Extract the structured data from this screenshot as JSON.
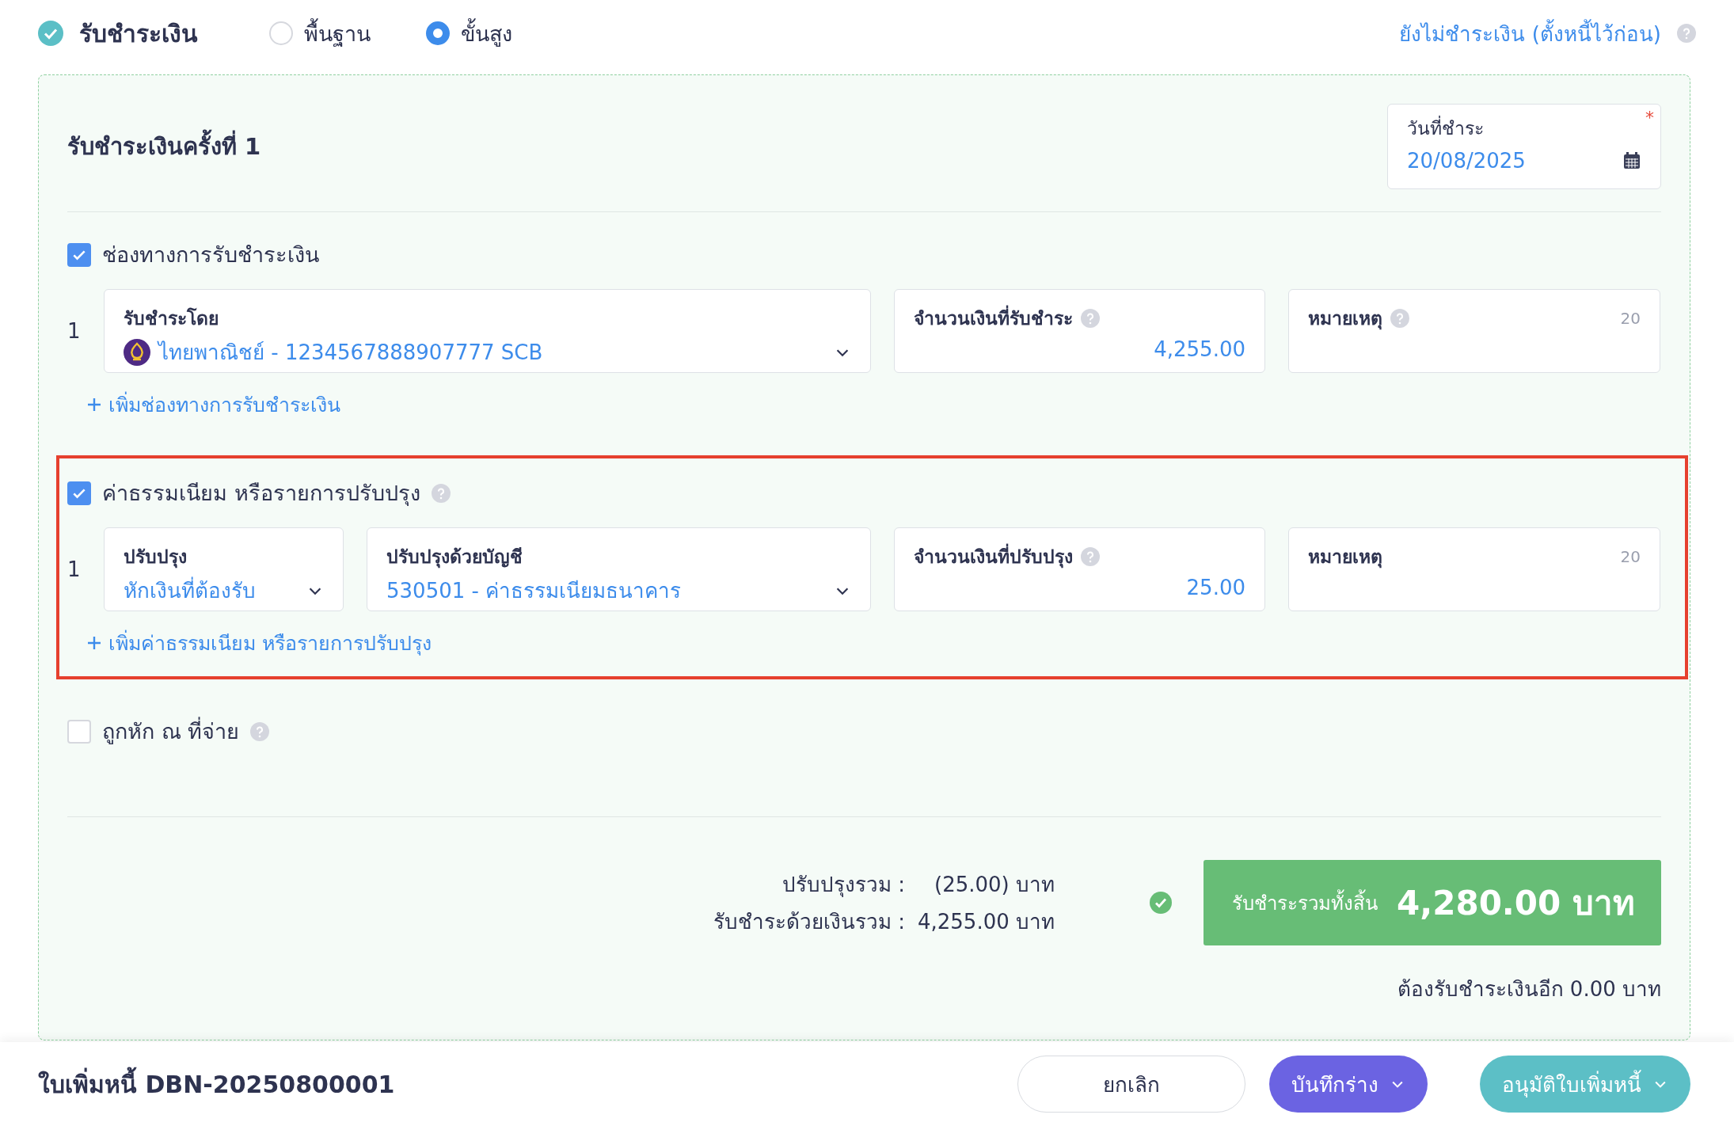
{
  "header": {
    "title": "รับชำระเงิน",
    "modes": [
      {
        "label": "พื้นฐาน",
        "selected": false
      },
      {
        "label": "ขั้นสูง",
        "selected": true
      }
    ],
    "defer_link": "ยังไม่ชำระเงิน (ตั้งหนี้ไว้ก่อน)"
  },
  "payment": {
    "title": "รับชำระเงินครั้งที่ 1",
    "date_field": {
      "label": "วันที่ชำระ",
      "value": "20/08/2025",
      "required_mark": "*"
    },
    "sections": [
      {
        "label": "ช่องทางการรับชำระเงิน",
        "checked": true,
        "help": false,
        "highlighted": false,
        "add_link": "เพิ่มช่องทางการรับชำระเงิน",
        "rows": [
          {
            "number": "1",
            "fields": [
              {
                "kind": "select",
                "label": "รับชำระโดย",
                "value": "ไทยพาณิชย์ - 1234567888907777 SCB",
                "bank_logo": true
              },
              {
                "kind": "amount",
                "label": "จำนวนเงินที่รับชำระ",
                "help": true,
                "value": "4,255.00"
              },
              {
                "kind": "note",
                "label": "หมายเหตุ",
                "help": true,
                "counter": "20"
              }
            ]
          }
        ]
      },
      {
        "label": "ค่าธรรมเนียม หรือรายการปรับปรุง",
        "checked": true,
        "help": true,
        "highlighted": true,
        "add_link": "เพิ่มค่าธรรมเนียม หรือรายการปรับปรุง",
        "rows": [
          {
            "number": "1",
            "fields": [
              {
                "kind": "select",
                "label": "ปรับปรุง",
                "value": "หักเงินที่ต้องรับ",
                "bank_logo": false
              },
              {
                "kind": "select",
                "label": "ปรับปรุงด้วยบัญชี",
                "value": "530501 - ค่าธรรมเนียมธนาคาร",
                "bank_logo": false
              },
              {
                "kind": "amount",
                "label": "จำนวนเงินที่ปรับปรุง",
                "help": true,
                "value": "25.00"
              },
              {
                "kind": "note",
                "label": "หมายเหตุ",
                "help": false,
                "counter": "20"
              }
            ]
          }
        ]
      },
      {
        "label": "ถูกหัก ณ ที่จ่าย",
        "checked": false,
        "help": true,
        "highlighted": false
      }
    ],
    "summary": {
      "lines": [
        {
          "label": "ปรับปรุงรวม :",
          "value": "(25.00) บาท"
        },
        {
          "label": "รับชำระด้วยเงินรวม :",
          "value": "4,255.00 บาท"
        }
      ],
      "total_label": "รับชำระรวมทั้งสิ้น",
      "total_value": "4,280.00 บาท",
      "remaining": "ต้องรับชำระเงินอีก 0.00 บาท"
    }
  },
  "footer": {
    "document": "ใบเพิ่มหนี้ DBN-20250800001",
    "buttons": [
      {
        "label": "ยกเลิก",
        "kind": "cancel",
        "dropdown": false
      },
      {
        "label": "บันทึกร่าง",
        "kind": "draft",
        "dropdown": true
      },
      {
        "label": "อนุมัติใบเพิ่มหนี้",
        "kind": "approve",
        "dropdown": true
      }
    ]
  }
}
